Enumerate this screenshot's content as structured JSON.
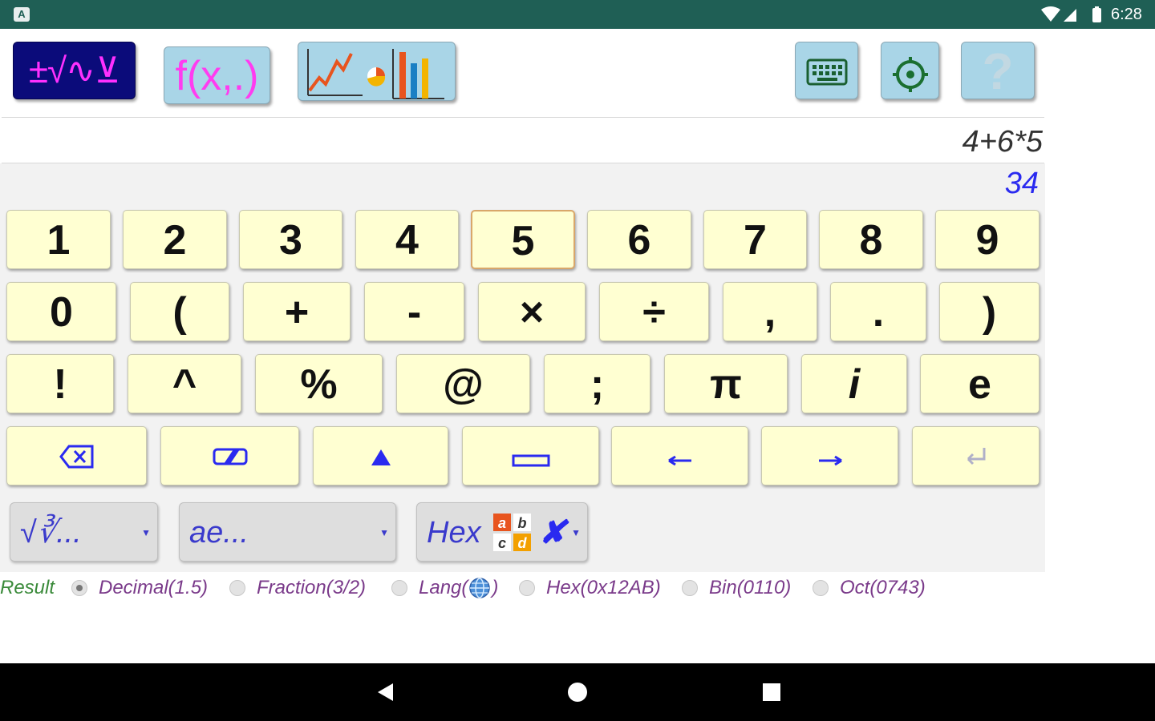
{
  "status_bar": {
    "time": "6:28",
    "app_badge": "A"
  },
  "toolbar": {
    "math_label": "±√∿⊻",
    "func_label": "f(x,.)",
    "help_label": "?"
  },
  "expression": "4+6*5",
  "result": "34",
  "keys": {
    "row1": [
      "1",
      "2",
      "3",
      "4",
      "5",
      "6",
      "7",
      "8",
      "9"
    ],
    "row2": [
      "0",
      "(",
      "+",
      "-",
      "×",
      "÷",
      ",",
      ".",
      ")"
    ],
    "row3": [
      "!",
      "^",
      "%",
      "@",
      ";",
      "π",
      "i",
      "e"
    ]
  },
  "selects": {
    "root": "√∛...",
    "const": "ae...",
    "hex": "Hex"
  },
  "result_options": {
    "label": "Result",
    "options": [
      "Decimal(1.5)",
      "Fraction(3/2)",
      "Lang(",
      "Hex(0x12AB)",
      "Bin(0110)",
      "Oct(0743)"
    ],
    "lang_suffix": ")",
    "selected": "Decimal(1.5)"
  },
  "colors": {
    "status_bar": "#1f5f55",
    "key_bg": "#ffffd2",
    "accent_blue": "#2a2af0"
  }
}
